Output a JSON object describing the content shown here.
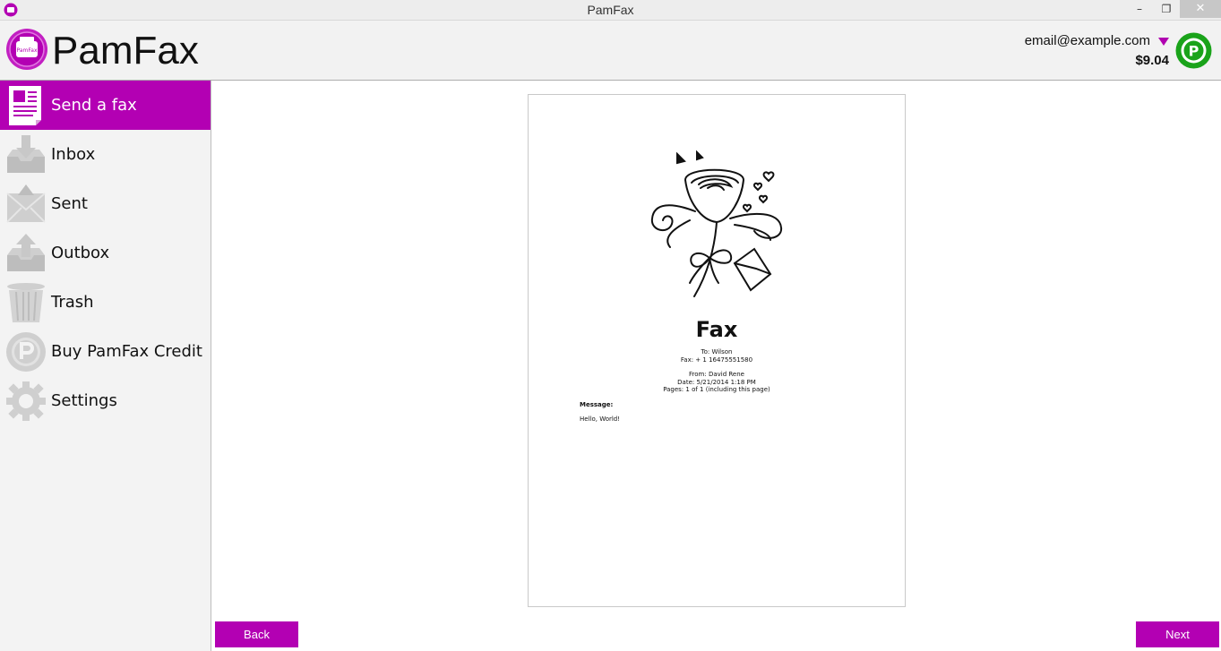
{
  "window": {
    "title": "PamFax",
    "minimize_glyph": "–",
    "restore_glyph": "❐",
    "close_glyph": "✕"
  },
  "header": {
    "brand": "PamFax",
    "logo_text": "PamFax",
    "account_email": "email@example.com",
    "balance": "$9.04",
    "credit_badge_letter": "P"
  },
  "sidebar": {
    "items": [
      {
        "label": "Send a fax",
        "icon": "document-icon",
        "active": true
      },
      {
        "label": "Inbox",
        "icon": "inbox-tray-icon",
        "active": false
      },
      {
        "label": "Sent",
        "icon": "sent-tray-icon",
        "active": false
      },
      {
        "label": "Outbox",
        "icon": "outbox-tray-icon",
        "active": false
      },
      {
        "label": "Trash",
        "icon": "trash-can-icon",
        "active": false
      },
      {
        "label": "Buy PamFax Credit",
        "icon": "credit-coin-icon",
        "active": false
      },
      {
        "label": "Settings",
        "icon": "gear-icon",
        "active": false
      }
    ]
  },
  "fax": {
    "title": "Fax",
    "to": "To: Wilson",
    "fax_number": "Fax: + 1 16475551580",
    "from": "From: David Rene",
    "date": "Date: 5/21/2014 1:18 PM",
    "pages": "Pages: 1 of 1 (including this page)",
    "message_label": "Message:",
    "message_body": "Hello, World!"
  },
  "buttons": {
    "back": "Back",
    "next": "Next"
  },
  "colors": {
    "accent": "#b300b3",
    "credit_green": "#1aa31a"
  }
}
